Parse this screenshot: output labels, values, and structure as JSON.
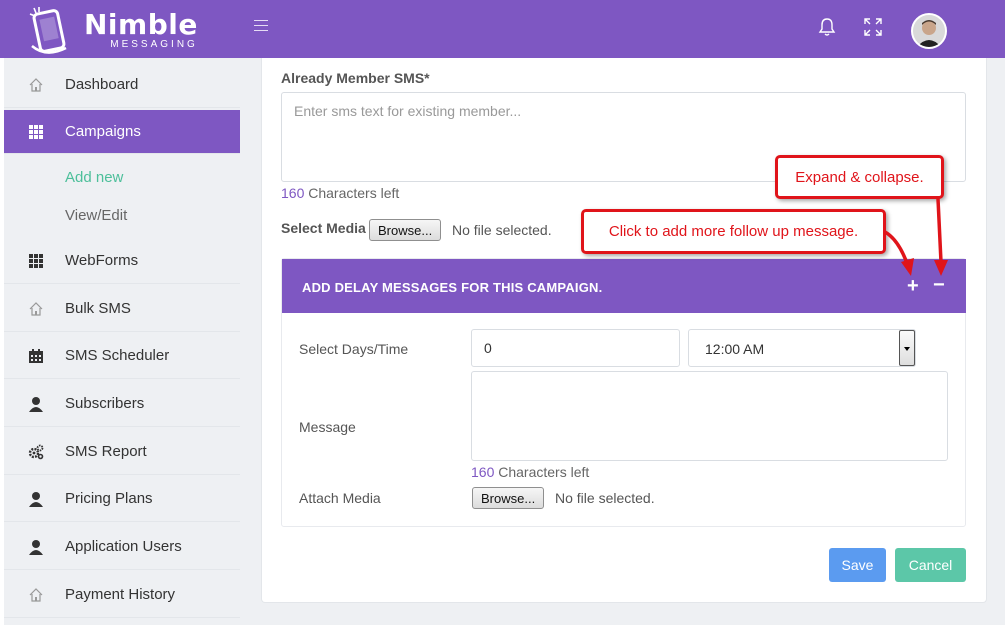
{
  "header": {
    "brand_name": "Nimble",
    "brand_sub": "MESSAGING",
    "menu_icon": "hamburger-icon",
    "notification_icon": "bell-icon",
    "fullscreen_icon": "expand-icon",
    "user_icon": "user-avatar"
  },
  "sidebar": {
    "items": [
      {
        "label": "Dashboard",
        "icon": "home-icon"
      },
      {
        "label": "Campaigns",
        "icon": "grid-icon",
        "active": true
      },
      {
        "label": "Add new"
      },
      {
        "label": "View/Edit"
      },
      {
        "label": "WebForms",
        "icon": "grid-icon"
      },
      {
        "label": "Bulk SMS",
        "icon": "home-icon"
      },
      {
        "label": "SMS Scheduler",
        "icon": "calendar-icon"
      },
      {
        "label": "Subscribers",
        "icon": "user-icon"
      },
      {
        "label": "SMS Report",
        "icon": "gears-icon"
      },
      {
        "label": "Pricing Plans",
        "icon": "user-icon"
      },
      {
        "label": "Application Users",
        "icon": "user-icon"
      },
      {
        "label": "Payment History",
        "icon": "home-icon"
      }
    ]
  },
  "form": {
    "member_sms_label": "Already Member SMS*",
    "member_sms_placeholder": "Enter sms text for existing member...",
    "member_sms_value": "",
    "chars_count": "160",
    "chars_text": " Characters left",
    "media_label": "Select Media",
    "browse_label": "Browse...",
    "no_file": "No file selected."
  },
  "delay": {
    "title": "ADD DELAY MESSAGES FOR THIS CAMPAIGN.",
    "add_symbol": "+",
    "collapse_symbol": "−",
    "days_label": "Select Days/Time",
    "days_value": "0",
    "time_value": "12:00 AM",
    "message_label": "Message",
    "message_value": "",
    "chars_count": "160",
    "chars_text": " Characters left",
    "attach_label": "Attach Media",
    "browse_label": "Browse...",
    "no_file": "No file selected."
  },
  "actions": {
    "save_label": "Save",
    "cancel_label": "Cancel"
  },
  "callouts": {
    "expand_collapse": "Expand & collapse.",
    "add_more": "Click to add more follow up message."
  },
  "colors": {
    "brand": "#7e57c2",
    "save": "#5b9bf0",
    "cancel": "#5cc7a8",
    "annotation": "#e0141a"
  }
}
